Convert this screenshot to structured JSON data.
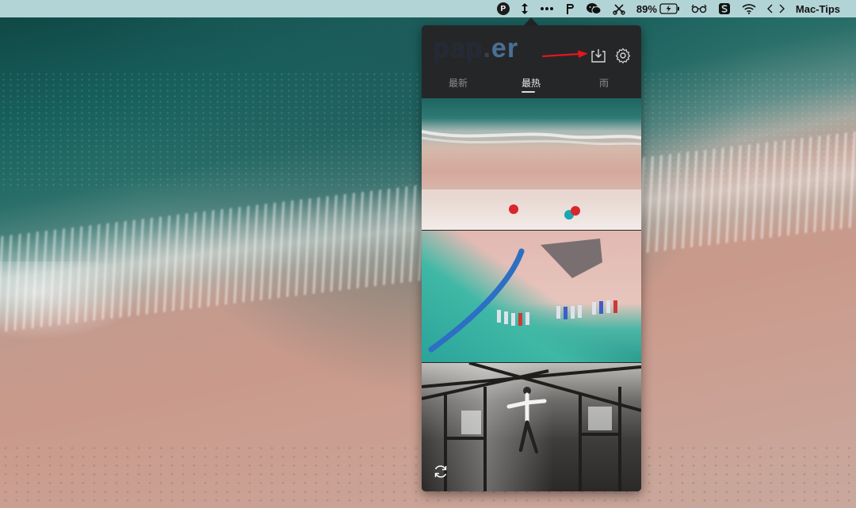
{
  "menubar": {
    "app_badge": "P",
    "battery_percent": "89%",
    "right_label": "Mac-Tips"
  },
  "popover": {
    "logo_main": "pap",
    "logo_dot": ".",
    "logo_er": "er",
    "tabs": [
      {
        "label": "最新",
        "active": false
      },
      {
        "label": "最热",
        "active": true
      },
      {
        "label": "雨",
        "active": false
      }
    ]
  },
  "colors": {
    "menubar": "#b3d4d6",
    "popover_bg": "#252628",
    "annotation_arrow": "#e0181b"
  }
}
